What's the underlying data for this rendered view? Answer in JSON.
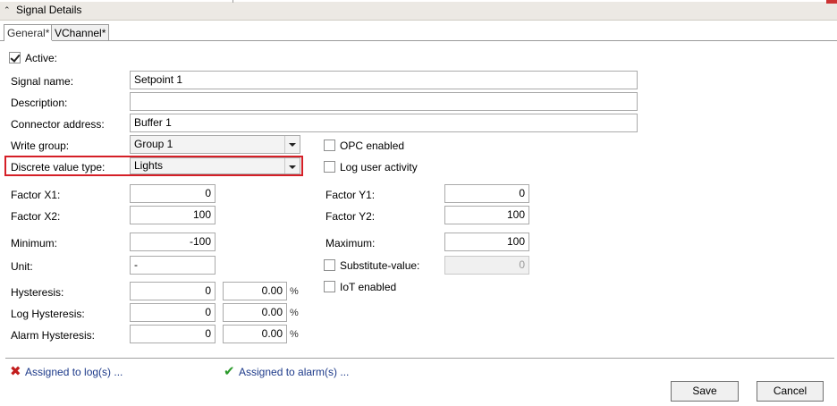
{
  "panel": {
    "title": "Signal Details"
  },
  "tabs": [
    {
      "label": "General*"
    },
    {
      "label": "VChannel*"
    }
  ],
  "general": {
    "active": {
      "label": "Active:",
      "checked": true
    },
    "signal_name": {
      "label": "Signal name:",
      "value": "Setpoint 1"
    },
    "description": {
      "label": "Description:",
      "value": ""
    },
    "connector_address": {
      "label": "Connector address:",
      "value": "Buffer 1"
    },
    "write_group": {
      "label": "Write group:",
      "value": "Group 1"
    },
    "discrete_value_type": {
      "label": "Discrete value type:",
      "value": "Lights"
    },
    "opc_enabled": {
      "label": "OPC enabled",
      "checked": false
    },
    "log_user_activity": {
      "label": "Log user activity",
      "checked": false
    },
    "factor_x1": {
      "label": "Factor X1:",
      "value": "0"
    },
    "factor_x2": {
      "label": "Factor X2:",
      "value": "100"
    },
    "factor_y1": {
      "label": "Factor Y1:",
      "value": "0"
    },
    "factor_y2": {
      "label": "Factor Y2:",
      "value": "100"
    },
    "minimum": {
      "label": "Minimum:",
      "value": "-100"
    },
    "maximum": {
      "label": "Maximum:",
      "value": "100"
    },
    "unit": {
      "label": "Unit:",
      "value": "-"
    },
    "substitute_value": {
      "label": "Substitute-value:",
      "value": "0",
      "checked": false
    },
    "iot_enabled": {
      "label": "IoT enabled",
      "checked": false
    },
    "hysteresis": {
      "label": "Hysteresis:",
      "value": "0",
      "percent": "0.00",
      "unit": "%"
    },
    "log_hysteresis": {
      "label": "Log Hysteresis:",
      "value": "0",
      "percent": "0.00",
      "unit": "%"
    },
    "alarm_hysteresis": {
      "label": "Alarm Hysteresis:",
      "value": "0",
      "percent": "0.00",
      "unit": "%"
    }
  },
  "footer": {
    "assigned_logs": {
      "label": "Assigned to log(s) ...",
      "icon": "cross-icon",
      "color": "#c21d1d"
    },
    "assigned_alarms": {
      "label": "Assigned to alarm(s) ...",
      "icon": "check-icon",
      "color": "#2a9a2a"
    },
    "save_label": "Save",
    "cancel_label": "Cancel"
  },
  "colors": {
    "highlight": "#d51f27",
    "link": "#1d3a8a",
    "header_bg": "#ece9e4"
  }
}
